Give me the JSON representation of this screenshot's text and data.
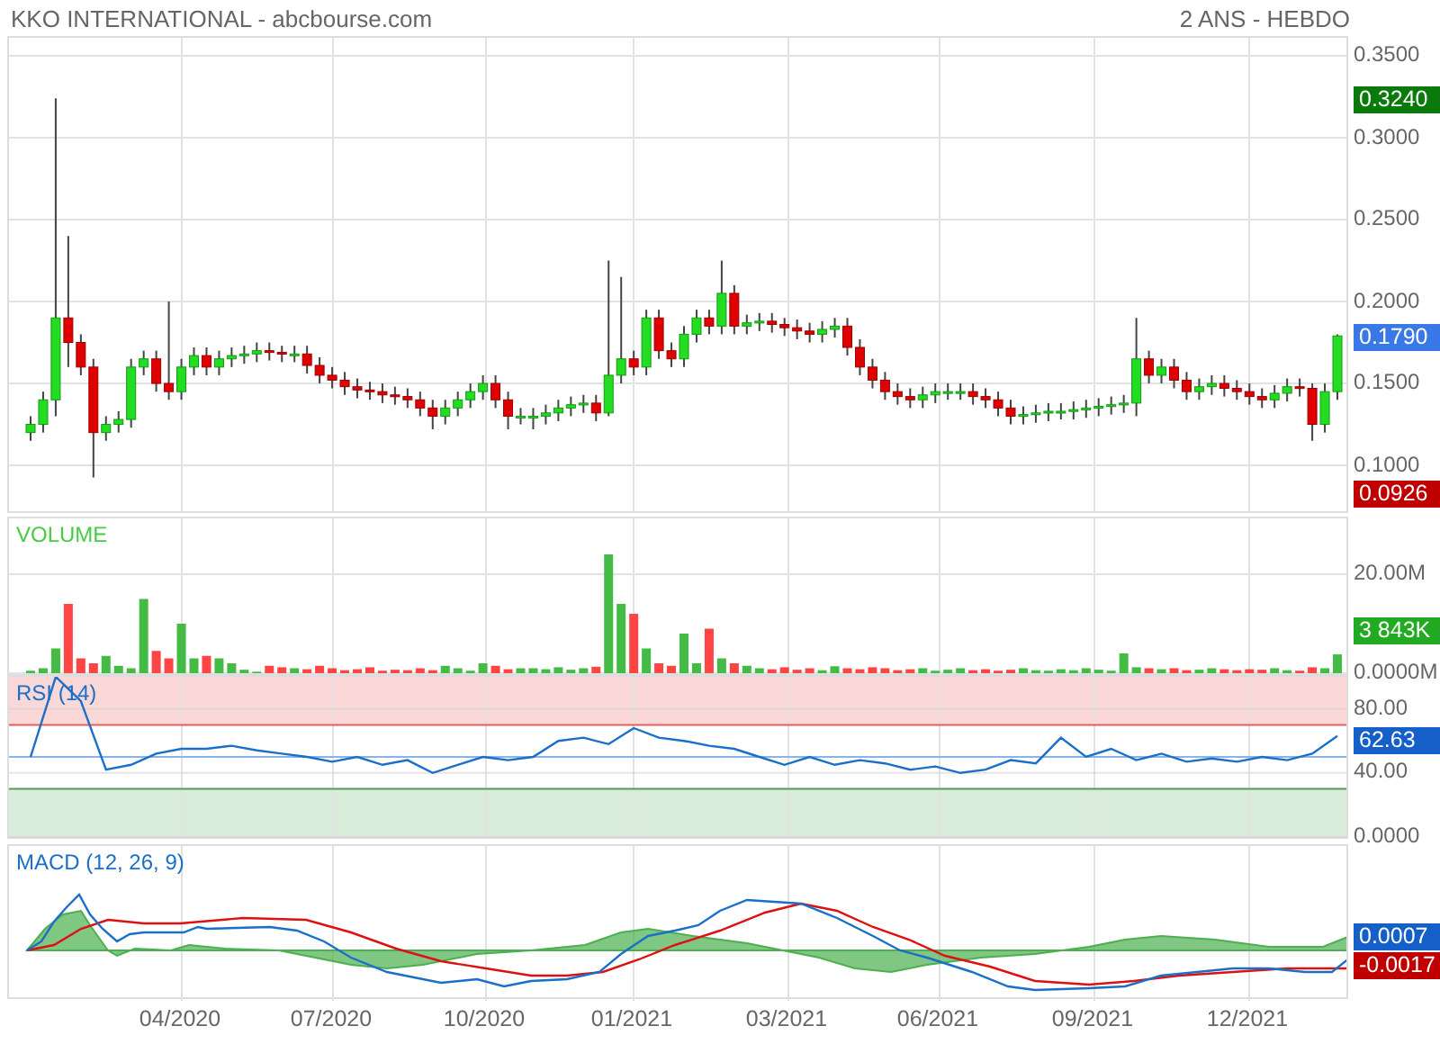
{
  "header": {
    "title": "KKO INTERNATIONAL - abcbourse.com",
    "period": "2 ANS - HEBDO"
  },
  "price_panel": {
    "badges": [
      {
        "text": "0.3240",
        "color": "#0a7a0a"
      },
      {
        "text": "0.1790",
        "color": "#3a78e8"
      },
      {
        "text": "0.0926",
        "color": "#c00000"
      }
    ],
    "chart_data": {
      "type": "candlestick",
      "grid": true,
      "ylim": [
        0.072,
        0.361
      ],
      "yticks": [
        {
          "value": 0.35,
          "label": "0.3500"
        },
        {
          "value": 0.3,
          "label": "0.3000"
        },
        {
          "value": 0.25,
          "label": "0.2500"
        },
        {
          "value": 0.2,
          "label": "0.2000"
        },
        {
          "value": 0.15,
          "label": "0.1500"
        },
        {
          "value": 0.1,
          "label": "0.1000"
        }
      ],
      "ohlc": [
        [
          0.12,
          0.13,
          0.115,
          0.125
        ],
        [
          0.125,
          0.145,
          0.12,
          0.14
        ],
        [
          0.14,
          0.324,
          0.13,
          0.19
        ],
        [
          0.19,
          0.24,
          0.16,
          0.175
        ],
        [
          0.175,
          0.18,
          0.155,
          0.16
        ],
        [
          0.16,
          0.165,
          0.0926,
          0.12
        ],
        [
          0.12,
          0.13,
          0.115,
          0.125
        ],
        [
          0.125,
          0.133,
          0.12,
          0.128
        ],
        [
          0.128,
          0.165,
          0.123,
          0.16
        ],
        [
          0.16,
          0.17,
          0.155,
          0.165
        ],
        [
          0.165,
          0.17,
          0.145,
          0.15
        ],
        [
          0.15,
          0.2,
          0.14,
          0.145
        ],
        [
          0.145,
          0.165,
          0.14,
          0.16
        ],
        [
          0.16,
          0.172,
          0.155,
          0.167
        ],
        [
          0.167,
          0.172,
          0.155,
          0.16
        ],
        [
          0.16,
          0.17,
          0.155,
          0.165
        ],
        [
          0.165,
          0.172,
          0.16,
          0.167
        ],
        [
          0.167,
          0.173,
          0.162,
          0.168
        ],
        [
          0.168,
          0.175,
          0.163,
          0.17
        ],
        [
          0.17,
          0.175,
          0.164,
          0.169
        ],
        [
          0.169,
          0.173,
          0.163,
          0.168
        ],
        [
          0.168,
          0.173,
          0.163,
          0.168
        ],
        [
          0.168,
          0.173,
          0.156,
          0.161
        ],
        [
          0.161,
          0.166,
          0.15,
          0.155
        ],
        [
          0.155,
          0.16,
          0.147,
          0.152
        ],
        [
          0.152,
          0.157,
          0.143,
          0.148
        ],
        [
          0.148,
          0.153,
          0.141,
          0.146
        ],
        [
          0.146,
          0.151,
          0.14,
          0.145
        ],
        [
          0.145,
          0.15,
          0.138,
          0.143
        ],
        [
          0.143,
          0.148,
          0.137,
          0.142
        ],
        [
          0.142,
          0.147,
          0.135,
          0.14
        ],
        [
          0.14,
          0.145,
          0.13,
          0.135
        ],
        [
          0.135,
          0.14,
          0.122,
          0.13
        ],
        [
          0.13,
          0.14,
          0.125,
          0.135
        ],
        [
          0.135,
          0.145,
          0.13,
          0.14
        ],
        [
          0.14,
          0.15,
          0.135,
          0.145
        ],
        [
          0.145,
          0.155,
          0.14,
          0.15
        ],
        [
          0.15,
          0.155,
          0.135,
          0.14
        ],
        [
          0.14,
          0.145,
          0.122,
          0.13
        ],
        [
          0.13,
          0.135,
          0.125,
          0.13
        ],
        [
          0.13,
          0.135,
          0.122,
          0.13
        ],
        [
          0.13,
          0.137,
          0.125,
          0.132
        ],
        [
          0.132,
          0.14,
          0.127,
          0.135
        ],
        [
          0.135,
          0.142,
          0.13,
          0.137
        ],
        [
          0.137,
          0.143,
          0.132,
          0.138
        ],
        [
          0.138,
          0.143,
          0.127,
          0.132
        ],
        [
          0.132,
          0.225,
          0.13,
          0.155
        ],
        [
          0.155,
          0.215,
          0.15,
          0.165
        ],
        [
          0.165,
          0.17,
          0.155,
          0.16
        ],
        [
          0.16,
          0.195,
          0.155,
          0.19
        ],
        [
          0.19,
          0.195,
          0.165,
          0.17
        ],
        [
          0.17,
          0.175,
          0.16,
          0.165
        ],
        [
          0.165,
          0.185,
          0.16,
          0.18
        ],
        [
          0.18,
          0.195,
          0.175,
          0.19
        ],
        [
          0.19,
          0.195,
          0.18,
          0.185
        ],
        [
          0.185,
          0.225,
          0.18,
          0.205
        ],
        [
          0.205,
          0.21,
          0.18,
          0.185
        ],
        [
          0.185,
          0.192,
          0.18,
          0.187
        ],
        [
          0.187,
          0.193,
          0.182,
          0.188
        ],
        [
          0.188,
          0.193,
          0.181,
          0.186
        ],
        [
          0.186,
          0.19,
          0.179,
          0.184
        ],
        [
          0.184,
          0.189,
          0.177,
          0.182
        ],
        [
          0.182,
          0.187,
          0.175,
          0.18
        ],
        [
          0.18,
          0.188,
          0.175,
          0.183
        ],
        [
          0.183,
          0.19,
          0.178,
          0.185
        ],
        [
          0.185,
          0.19,
          0.167,
          0.172
        ],
        [
          0.172,
          0.177,
          0.155,
          0.16
        ],
        [
          0.16,
          0.165,
          0.147,
          0.152
        ],
        [
          0.152,
          0.157,
          0.14,
          0.145
        ],
        [
          0.145,
          0.15,
          0.137,
          0.142
        ],
        [
          0.142,
          0.147,
          0.135,
          0.14
        ],
        [
          0.14,
          0.148,
          0.135,
          0.143
        ],
        [
          0.143,
          0.15,
          0.138,
          0.145
        ],
        [
          0.145,
          0.15,
          0.14,
          0.145
        ],
        [
          0.145,
          0.15,
          0.14,
          0.145
        ],
        [
          0.145,
          0.15,
          0.137,
          0.142
        ],
        [
          0.142,
          0.147,
          0.135,
          0.14
        ],
        [
          0.14,
          0.145,
          0.13,
          0.135
        ],
        [
          0.135,
          0.14,
          0.125,
          0.13
        ],
        [
          0.13,
          0.136,
          0.125,
          0.131
        ],
        [
          0.131,
          0.137,
          0.126,
          0.132
        ],
        [
          0.132,
          0.138,
          0.127,
          0.133
        ],
        [
          0.133,
          0.138,
          0.128,
          0.133
        ],
        [
          0.133,
          0.139,
          0.128,
          0.134
        ],
        [
          0.134,
          0.14,
          0.129,
          0.135
        ],
        [
          0.135,
          0.141,
          0.13,
          0.136
        ],
        [
          0.136,
          0.142,
          0.131,
          0.137
        ],
        [
          0.137,
          0.143,
          0.132,
          0.138
        ],
        [
          0.138,
          0.19,
          0.13,
          0.165
        ],
        [
          0.165,
          0.17,
          0.15,
          0.155
        ],
        [
          0.155,
          0.165,
          0.15,
          0.16
        ],
        [
          0.16,
          0.165,
          0.147,
          0.152
        ],
        [
          0.152,
          0.157,
          0.14,
          0.145
        ],
        [
          0.145,
          0.153,
          0.14,
          0.148
        ],
        [
          0.148,
          0.155,
          0.143,
          0.15
        ],
        [
          0.15,
          0.155,
          0.142,
          0.147
        ],
        [
          0.147,
          0.152,
          0.14,
          0.145
        ],
        [
          0.145,
          0.15,
          0.137,
          0.142
        ],
        [
          0.142,
          0.147,
          0.135,
          0.14
        ],
        [
          0.14,
          0.149,
          0.135,
          0.144
        ],
        [
          0.144,
          0.153,
          0.139,
          0.148
        ],
        [
          0.148,
          0.153,
          0.142,
          0.147
        ],
        [
          0.147,
          0.15,
          0.115,
          0.125
        ],
        [
          0.125,
          0.15,
          0.12,
          0.145
        ],
        [
          0.145,
          0.18,
          0.14,
          0.179
        ]
      ]
    }
  },
  "volume_panel": {
    "badge": {
      "text": "3 843K",
      "color": "#22aa22"
    },
    "chart_data": {
      "type": "bar",
      "title": "VOLUME",
      "grid": true,
      "yticks": [
        {
          "value": 0,
          "label": "0.0000M"
        },
        {
          "value": 20,
          "label": "20.00M"
        }
      ],
      "ylim": [
        0,
        32
      ],
      "values": [
        0.5,
        1,
        5,
        14,
        3,
        2,
        3.5,
        1.5,
        1,
        15,
        4.5,
        3,
        10,
        3,
        3.5,
        3,
        2,
        0.7,
        0.3,
        1.5,
        1.2,
        1,
        0.8,
        1.5,
        1,
        0.6,
        0.8,
        1.2,
        0.5,
        0.7,
        0.6,
        1,
        0.6,
        1.5,
        1,
        0.5,
        2,
        1.5,
        0.8,
        1,
        1,
        0.8,
        1.2,
        0.7,
        1,
        1.3,
        24,
        14,
        12,
        5,
        2,
        1.5,
        8,
        2,
        9,
        3,
        2,
        1.5,
        1,
        0.8,
        1.2,
        0.7,
        1,
        0.6,
        1.4,
        1,
        0.8,
        1.2,
        1,
        0.6,
        0.8,
        1,
        0.5,
        0.7,
        1,
        0.6,
        0.8,
        0.5,
        0.7,
        1,
        0.6,
        0.5,
        0.8,
        0.6,
        1,
        0.7,
        0.5,
        4,
        1.2,
        1,
        0.8,
        1,
        0.6,
        0.7,
        1,
        0.8,
        0.6,
        0.8,
        0.7,
        1,
        0.6,
        0.5,
        1.2,
        1,
        3.8
      ]
    }
  },
  "rsi_panel": {
    "badge": {
      "text": "62.63",
      "color": "#1560c8"
    },
    "chart_data": {
      "type": "line",
      "title": "RSI (14)",
      "grid": true,
      "ylim": [
        0,
        100
      ],
      "bands": [
        {
          "axis": "y",
          "from": 70,
          "to": 100,
          "color": "#fbd8d8"
        },
        {
          "axis": "y",
          "from": 0,
          "to": 30,
          "color": "#d9ecd9"
        }
      ],
      "ref_lines": [
        {
          "axis": "y",
          "value": 70,
          "color": "#e06060"
        },
        {
          "axis": "y",
          "value": 30,
          "color": "#559955"
        },
        {
          "axis": "y",
          "value": 50,
          "color": "#8ab4e8"
        }
      ],
      "yticks": [
        {
          "value": 0,
          "label": "0.0000"
        },
        {
          "value": 40,
          "label": "40.00"
        },
        {
          "value": 80,
          "label": "80.00"
        }
      ],
      "series": [
        {
          "color": "#1a6fc9",
          "values": [
            50,
            100,
            85,
            42,
            45,
            52,
            55,
            55,
            57,
            54,
            52,
            50,
            47,
            50,
            45,
            48,
            40,
            45,
            50,
            48,
            50,
            60,
            62,
            58,
            68,
            62,
            60,
            57,
            55,
            50,
            45,
            50,
            45,
            48,
            46,
            42,
            44,
            40,
            42,
            48,
            46,
            62,
            50,
            55,
            48,
            52,
            47,
            49,
            47,
            50,
            48,
            52,
            63
          ]
        }
      ]
    }
  },
  "macd_panel": {
    "label": "MACD (12, 26, 9)",
    "badges": [
      {
        "text": "0.0007",
        "color": "#1560c8"
      },
      {
        "text": "-0.0017",
        "color": "#c00000"
      }
    ]
  },
  "x_axis": {
    "labels": [
      "04/2020",
      "07/2020",
      "10/2020",
      "01/2021",
      "03/2021",
      "06/2021",
      "09/2021",
      "12/2021"
    ]
  }
}
